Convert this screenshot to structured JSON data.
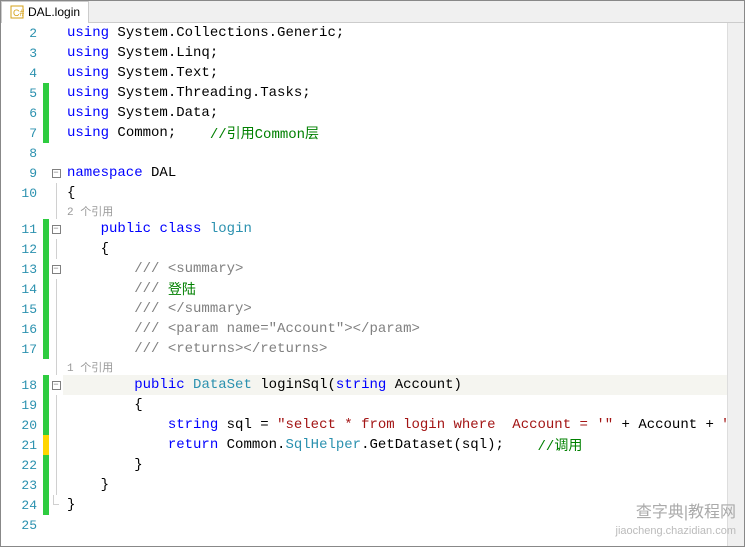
{
  "tab": {
    "title": "DAL.login"
  },
  "refs": {
    "class_ref": "2 个引用",
    "method_ref": "1 个引用"
  },
  "code": {
    "l2": {
      "kw": "using",
      "ns": " System.Collections.Generic;"
    },
    "l3": {
      "kw": "using",
      "ns": " System.Linq;"
    },
    "l4": {
      "kw": "using",
      "ns": " System.Text;"
    },
    "l5": {
      "kw": "using",
      "ns": " System.Threading.Tasks;"
    },
    "l6": {
      "kw": "using",
      "ns": " System.Data;"
    },
    "l7": {
      "kw": "using",
      "ns": " Common;",
      "com": "    //引用Common层"
    },
    "l9": {
      "kw": "namespace",
      "ns": " DAL"
    },
    "l10": "{",
    "l11": {
      "indent": "    ",
      "mod": "public",
      "sp": " ",
      "cls": "class",
      "sp2": " ",
      "name": "login"
    },
    "l12": "    {",
    "l13": {
      "indent": "        ",
      "doc": "/// <summary>"
    },
    "l14": {
      "indent": "        ",
      "doc": "/// ",
      "txt": "登陆"
    },
    "l15": {
      "indent": "        ",
      "doc": "/// </summary>"
    },
    "l16": {
      "indent": "        ",
      "doc": "/// <param name=\"Account\"></param>"
    },
    "l17": {
      "indent": "        ",
      "doc": "/// <returns></returns>"
    },
    "l18": {
      "indent": "        ",
      "mod": "public",
      "sp": " ",
      "type": "DataSet",
      "sp2": " ",
      "name": "loginSql(",
      "ptype": "string",
      "pname": " Account)"
    },
    "l19": "        {",
    "l20": {
      "indent": "            ",
      "kw": "string",
      "var": " sql = ",
      "str": "\"select * from login where  Account = '\"",
      "mid": " + Account + ",
      "str2": "\"'\"",
      "end": ";"
    },
    "l21": {
      "indent": "            ",
      "kw": "return",
      "txt": " Common.",
      "type": "SqlHelper",
      "txt2": ".GetDataset(sql);",
      "com": "    //调用"
    },
    "l22": "        }",
    "l23": "    }",
    "l24": "}"
  },
  "watermark": {
    "line1": "查字典|教程网",
    "line2": "jiaocheng.chazidian.com"
  }
}
